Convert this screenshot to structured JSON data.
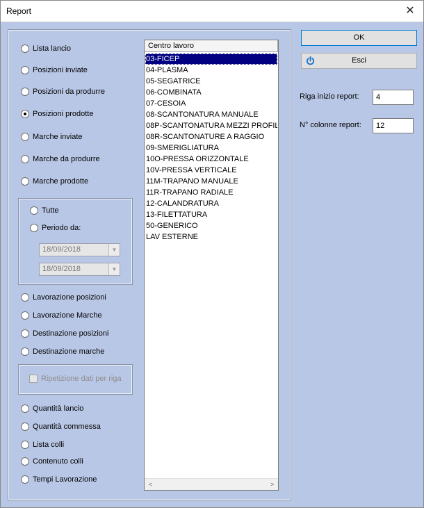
{
  "window": {
    "title": "Report",
    "close_glyph": "✕"
  },
  "report_types_a": [
    {
      "label": "Lista lancio",
      "selected": false
    },
    {
      "label": "Posizioni inviate",
      "selected": false
    },
    {
      "label": "Posizioni da produrre",
      "selected": false
    },
    {
      "label": "Posizioni prodotte",
      "selected": true
    },
    {
      "label": "Marche inviate",
      "selected": false
    },
    {
      "label": "Marche da produrre",
      "selected": false
    },
    {
      "label": "Marche prodotte",
      "selected": false
    }
  ],
  "period": {
    "all_label": "Tutte",
    "range_label": "Periodo da:",
    "date_from": "18/09/2018",
    "date_to": "18/09/2018"
  },
  "report_types_b": [
    {
      "label": "Lavorazione posizioni"
    },
    {
      "label": "Lavorazione Marche"
    },
    {
      "label": "Destinazione posizioni"
    },
    {
      "label": "Destinazione marche"
    }
  ],
  "repeat_data_label": "Ripetizione dati per riga",
  "report_types_c": [
    {
      "label": "Quantità lancio"
    },
    {
      "label": "Quantità commessa"
    },
    {
      "label": "Lista colli"
    },
    {
      "label": "Contenuto colli"
    },
    {
      "label": "Tempi Lavorazione"
    }
  ],
  "work_centers": {
    "header": "Centro lavoro",
    "selected_index": 0,
    "items": [
      "03-FICEP",
      "04-PLASMA",
      "05-SEGATRICE",
      "06-COMBINATA",
      "07-CESOIA",
      "08-SCANTONATURA MANUALE",
      "08P-SCANTONATURA MEZZI PROFILI",
      "08R-SCANTONATURE A RAGGIO",
      "09-SMERIGLIATURA",
      "10O-PRESSA ORIZZONTALE",
      "10V-PRESSA VERTICALE",
      "11M-TRAPANO MANUALE",
      "11R-TRAPANO RADIALE",
      "12-CALANDRATURA",
      "13-FILETTATURA",
      "50-GENERICO",
      "LAV ESTERNE"
    ],
    "scroll_left": "<",
    "scroll_right": ">"
  },
  "buttons": {
    "ok": "OK",
    "exit": "Esci",
    "exit_icon": "power-icon"
  },
  "settings": {
    "start_row_label": "Riga inizio report:",
    "start_row_value": "4",
    "columns_label": "N° colonne report:",
    "columns_value": "12"
  }
}
